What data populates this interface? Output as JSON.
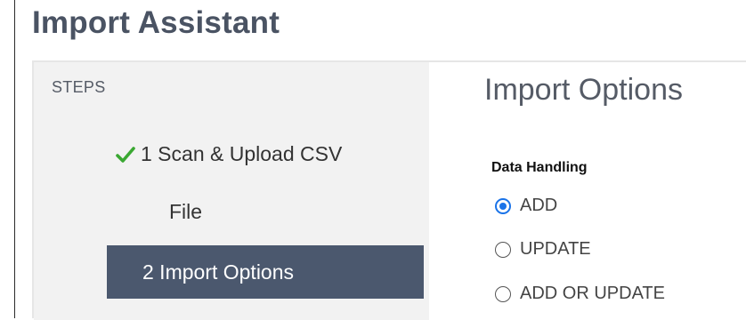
{
  "window": {
    "title": "Import Assistant"
  },
  "steps": {
    "heading": "STEPS",
    "completed_step": {
      "label_line1": "1 Scan & Upload CSV",
      "label_line2": "File",
      "icon": "check-icon"
    },
    "active_step": {
      "label": "2 Import Options"
    }
  },
  "main": {
    "title": "Import Options",
    "data_handling": {
      "label": "Data Handling",
      "selected": "ADD",
      "options": [
        {
          "label": "ADD",
          "checked": true
        },
        {
          "label": "UPDATE",
          "checked": false
        },
        {
          "label": "ADD OR UPDATE",
          "checked": false
        }
      ]
    }
  },
  "colors": {
    "title_text": "#4a5363",
    "active_step_bg": "#4b586e",
    "steps_panel_bg": "#f2f2f2",
    "check_green": "#3aa832",
    "radio_selected": "#1a73e8"
  }
}
